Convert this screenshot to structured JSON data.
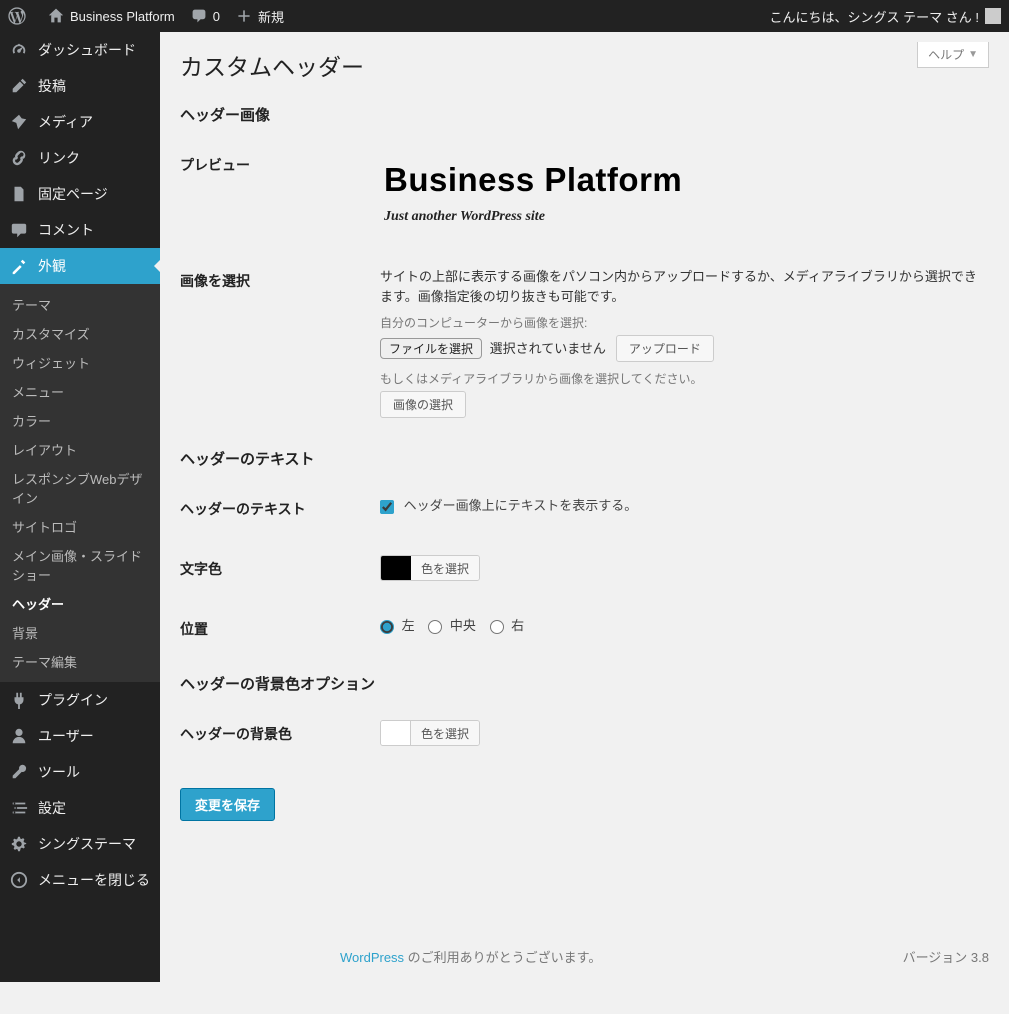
{
  "adminbar": {
    "site_name": "Business Platform",
    "comments": "0",
    "new_label": "新規",
    "greeting": "こんにちは、シングス テーマ さん !"
  },
  "sidebar": {
    "dashboard": "ダッシュボード",
    "posts": "投稿",
    "media": "メディア",
    "links": "リンク",
    "pages": "固定ページ",
    "comments": "コメント",
    "appearance": "外観",
    "plugins": "プラグイン",
    "users": "ユーザー",
    "tools": "ツール",
    "settings": "設定",
    "xings": "シングステーマ",
    "collapse": "メニューを閉じる",
    "appearance_sub": {
      "themes": "テーマ",
      "customize": "カスタマイズ",
      "widgets": "ウィジェット",
      "menus": "メニュー",
      "color": "カラー",
      "layout": "レイアウト",
      "responsive": "レスポンシブWebデザイン",
      "sitelogo": "サイトロゴ",
      "mainimage": "メイン画像・スライドショー",
      "header": "ヘッダー",
      "background": "背景",
      "edit_theme": "テーマ編集"
    }
  },
  "help": "ヘルプ",
  "page_title": "カスタムヘッダー",
  "section_header_image": "ヘッダー画像",
  "row_preview": "プレビュー",
  "preview_title": "Business Platform",
  "preview_tagline": "Just another WordPress site",
  "row_select_image": "画像を選択",
  "select_image_desc": "サイトの上部に表示する画像をパソコン内からアップロードするか、メディアライブラリから選択できます。画像指定後の切り抜きも可能です。",
  "upload_hint": "自分のコンピューターから画像を選択:",
  "file_button": "ファイルを選択",
  "file_status": "選択されていません",
  "upload_button": "アップロード",
  "media_hint": "もしくはメディアライブラリから画像を選択してください。",
  "media_button": "画像の選択",
  "section_header_text": "ヘッダーのテキスト",
  "row_header_text": "ヘッダーのテキスト",
  "checkbox_show_text": "ヘッダー画像上にテキストを表示する。",
  "row_text_color": "文字色",
  "color_pick_label": "色を選択",
  "row_position": "位置",
  "pos_left": "左",
  "pos_center": "中央",
  "pos_right": "右",
  "section_bg": "ヘッダーの背景色オプション",
  "row_bg_color": "ヘッダーの背景色",
  "submit": "変更を保存",
  "footer_link": "WordPress",
  "footer_text": " のご利用ありがとうございます。",
  "footer_version": "バージョン 3.8"
}
